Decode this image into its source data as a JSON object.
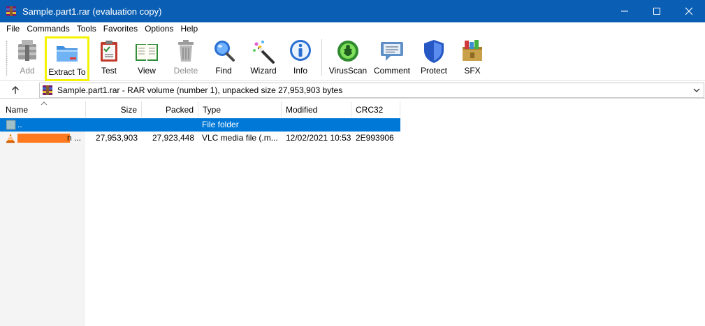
{
  "window": {
    "title": "Sample.part1.rar (evaluation copy)",
    "minimize_glyph": "—",
    "maximize_glyph": "☐",
    "close_glyph": "✕"
  },
  "menu": [
    "File",
    "Commands",
    "Tools",
    "Favorites",
    "Options",
    "Help"
  ],
  "toolbar": {
    "add": "Add",
    "extract_to": "Extract To",
    "test": "Test",
    "view": "View",
    "delete": "Delete",
    "find": "Find",
    "wizard": "Wizard",
    "info": "Info",
    "virusscan": "VirusScan",
    "comment": "Comment",
    "protect": "Protect",
    "sfx": "SFX"
  },
  "address": {
    "path": "Sample.part1.rar - RAR volume (number 1), unpacked size 27,953,903 bytes"
  },
  "columns": {
    "name": "Name",
    "size": "Size",
    "packed": "Packed",
    "type": "Type",
    "modified": "Modified",
    "crc": "CRC32"
  },
  "rows": [
    {
      "name": "..",
      "size": "",
      "packed": "",
      "type": "File folder",
      "modified": "",
      "crc": ""
    },
    {
      "name": "n ...",
      "size": "27,953,903",
      "packed": "27,923,448",
      "type": "VLC media file (.m...",
      "modified": "12/02/2021 10:53",
      "crc": "2E993906"
    }
  ],
  "colors": {
    "titlebar": "#0a5fb4",
    "selection": "#0078d7",
    "highlight_box": "#f6f300",
    "redaction": "#ff7a1f"
  }
}
